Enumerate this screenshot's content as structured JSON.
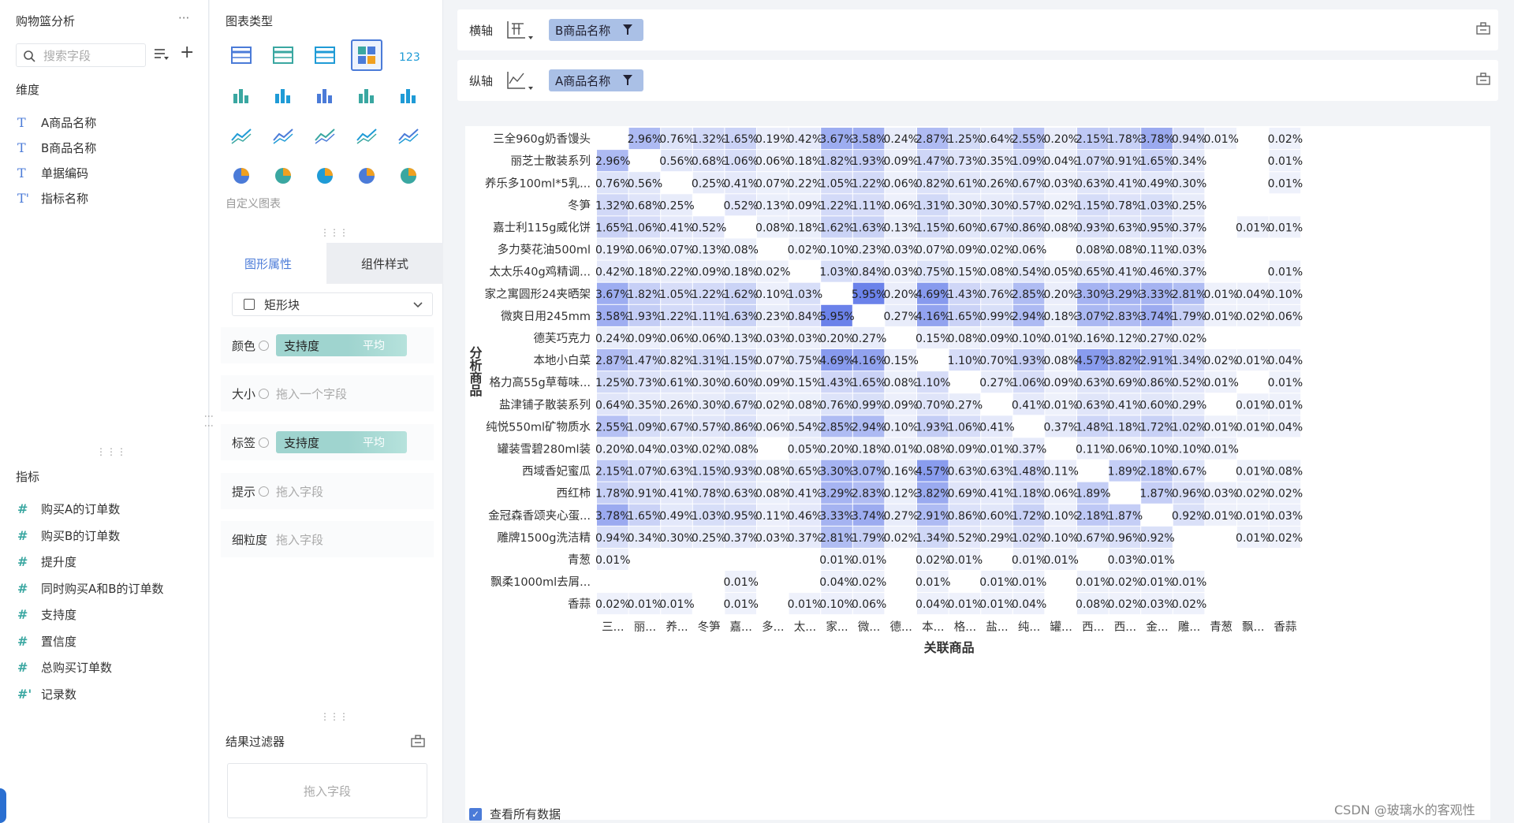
{
  "left_panel": {
    "title": "购物篮分析",
    "more": "···",
    "search_placeholder": "搜索字段",
    "dimensions_label": "维度",
    "dimensions": [
      {
        "icon": "T",
        "label": "A商品名称"
      },
      {
        "icon": "T",
        "label": "B商品名称"
      },
      {
        "icon": "T",
        "label": "单据编码"
      },
      {
        "icon": "T'",
        "label": "指标名称"
      }
    ],
    "measures_label": "指标",
    "measures": [
      {
        "icon": "#",
        "label": "购买A的订单数"
      },
      {
        "icon": "#",
        "label": "购买B的订单数"
      },
      {
        "icon": "#",
        "label": "提升度"
      },
      {
        "icon": "#",
        "label": "同时购买A和B的订单数"
      },
      {
        "icon": "#",
        "label": "支持度"
      },
      {
        "icon": "#",
        "label": "置信度"
      },
      {
        "icon": "#",
        "label": "总购买订单数"
      },
      {
        "icon": "#'",
        "label": "记录数"
      }
    ]
  },
  "config_panel": {
    "chart_type_title": "图表类型",
    "custom_chart_label": "自定义图表",
    "tab_graph": "图形属性",
    "tab_component": "组件样式",
    "shape_label": "矩形块",
    "props": [
      {
        "label": "颜色",
        "pill_name": "支持度",
        "pill_agg": "平均",
        "placeholder": ""
      },
      {
        "label": "大小",
        "pill_name": "",
        "pill_agg": "",
        "placeholder": "拖入一个字段"
      },
      {
        "label": "标签",
        "pill_name": "支持度",
        "pill_agg": "平均",
        "placeholder": ""
      },
      {
        "label": "提示",
        "pill_name": "",
        "pill_agg": "",
        "placeholder": "拖入字段"
      },
      {
        "label": "细粒度",
        "pill_name": "",
        "pill_agg": "",
        "placeholder": "拖入字段"
      }
    ],
    "result_filter_title": "结果过滤器",
    "filter_placeholder": "拖入字段",
    "chart_type_icons": [
      "table-icon",
      "cross-table-icon",
      "detail-table-icon",
      "heatmap-icon",
      "kpi-number-icon",
      "stacked-bar-icon",
      "bar-chart-icon",
      "grouped-bar-icon",
      "horizontal-bar-icon",
      "scatter-step-icon",
      "line-chart-icon",
      "line-point-icon",
      "radar-icon",
      "area-chart-icon",
      "gauge-icon",
      "pie-chart-icon",
      "rose-chart-icon",
      "donut-chart-icon",
      "scatter-icon",
      "bubble-icon"
    ]
  },
  "axes": {
    "x_label": "横轴",
    "x_field": "B商品名称",
    "y_label": "纵轴",
    "y_field": "A商品名称"
  },
  "view_all_data": "查看所有数据",
  "watermark": "CSDN @玻璃水的客观性",
  "colors": {
    "accent": "#4b7bd8",
    "heat_low": "#eef1fb",
    "heat_high": "#6b82ea"
  },
  "chart_data": {
    "type": "heatmap",
    "ylabel": "分析商品",
    "xlabel": "关联商品",
    "rows": [
      "三全960g奶香馒头",
      "丽芝士散装系列",
      "养乐多100ml*5乳...",
      "冬笋",
      "嘉士利115g威化饼",
      "多力葵花油500ml",
      "太太乐40g鸡精调...",
      "家之寓圆形24夹晒架",
      "微爽日用245mm",
      "德芙巧克力",
      "本地小白菜",
      "格力高55g草莓味...",
      "盐津铺子散装系列",
      "纯悦550ml矿物质水",
      "罐装雪碧280ml装",
      "西域香妃蜜瓜",
      "西红柿",
      "金冠森香颂夹心蛋...",
      "雕牌1500g洗洁精",
      "青葱",
      "飘柔1000ml去屑...",
      "香蒜"
    ],
    "columns": [
      "三...",
      "丽...",
      "养...",
      "冬笋",
      "嘉...",
      "多...",
      "太...",
      "家...",
      "微...",
      "德...",
      "本...",
      "格...",
      "盐...",
      "纯...",
      "罐...",
      "西...",
      "西...",
      "金...",
      "雕...",
      "青葱",
      "飘...",
      "香蒜"
    ],
    "values": [
      [
        null,
        2.96,
        0.76,
        1.32,
        1.65,
        0.19,
        0.42,
        3.67,
        3.58,
        0.24,
        2.87,
        1.25,
        0.64,
        2.55,
        0.2,
        2.15,
        1.78,
        3.78,
        0.94,
        0.01,
        null,
        0.02
      ],
      [
        2.96,
        null,
        0.56,
        0.68,
        1.06,
        0.06,
        0.18,
        1.82,
        1.93,
        0.09,
        1.47,
        0.73,
        0.35,
        1.09,
        0.04,
        1.07,
        0.91,
        1.65,
        0.34,
        null,
        null,
        0.01
      ],
      [
        0.76,
        0.56,
        null,
        0.25,
        0.41,
        0.07,
        0.22,
        1.05,
        1.22,
        0.06,
        0.82,
        0.61,
        0.26,
        0.67,
        0.03,
        0.63,
        0.41,
        0.49,
        0.3,
        null,
        null,
        0.01
      ],
      [
        1.32,
        0.68,
        0.25,
        null,
        0.52,
        0.13,
        0.09,
        1.22,
        1.11,
        0.06,
        1.31,
        0.3,
        0.3,
        0.57,
        0.02,
        1.15,
        0.78,
        1.03,
        0.25,
        null,
        null,
        null
      ],
      [
        1.65,
        1.06,
        0.41,
        0.52,
        null,
        0.08,
        0.18,
        1.62,
        1.63,
        0.13,
        1.15,
        0.6,
        0.67,
        0.86,
        0.08,
        0.93,
        0.63,
        0.95,
        0.37,
        null,
        0.01,
        0.01
      ],
      [
        0.19,
        0.06,
        0.07,
        0.13,
        0.08,
        null,
        0.02,
        0.1,
        0.23,
        0.03,
        0.07,
        0.09,
        0.02,
        0.06,
        null,
        0.08,
        0.08,
        0.11,
        0.03,
        null,
        null,
        null
      ],
      [
        0.42,
        0.18,
        0.22,
        0.09,
        0.18,
        0.02,
        null,
        1.03,
        0.84,
        0.03,
        0.75,
        0.15,
        0.08,
        0.54,
        0.05,
        0.65,
        0.41,
        0.46,
        0.37,
        null,
        null,
        0.01
      ],
      [
        3.67,
        1.82,
        1.05,
        1.22,
        1.62,
        0.1,
        1.03,
        null,
        5.95,
        0.2,
        4.69,
        1.43,
        0.76,
        2.85,
        0.2,
        3.3,
        3.29,
        3.33,
        2.81,
        0.01,
        0.04,
        0.1
      ],
      [
        3.58,
        1.93,
        1.22,
        1.11,
        1.63,
        0.23,
        0.84,
        5.95,
        null,
        0.27,
        4.16,
        1.65,
        0.99,
        2.94,
        0.18,
        3.07,
        2.83,
        3.74,
        1.79,
        0.01,
        0.02,
        0.06
      ],
      [
        0.24,
        0.09,
        0.06,
        0.06,
        0.13,
        0.03,
        0.03,
        0.2,
        0.27,
        null,
        0.15,
        0.08,
        0.09,
        0.1,
        0.01,
        0.16,
        0.12,
        0.27,
        0.02,
        null,
        null,
        null
      ],
      [
        2.87,
        1.47,
        0.82,
        1.31,
        1.15,
        0.07,
        0.75,
        4.69,
        4.16,
        0.15,
        null,
        1.1,
        0.7,
        1.93,
        0.08,
        4.57,
        3.82,
        2.91,
        1.34,
        0.02,
        0.01,
        0.04
      ],
      [
        1.25,
        0.73,
        0.61,
        0.3,
        0.6,
        0.09,
        0.15,
        1.43,
        1.65,
        0.08,
        1.1,
        null,
        0.27,
        1.06,
        0.09,
        0.63,
        0.69,
        0.86,
        0.52,
        0.01,
        null,
        0.01
      ],
      [
        0.64,
        0.35,
        0.26,
        0.3,
        0.67,
        0.02,
        0.08,
        0.76,
        0.99,
        0.09,
        0.7,
        0.27,
        null,
        0.41,
        0.01,
        0.63,
        0.41,
        0.6,
        0.29,
        null,
        0.01,
        0.01
      ],
      [
        2.55,
        1.09,
        0.67,
        0.57,
        0.86,
        0.06,
        0.54,
        2.85,
        2.94,
        0.1,
        1.93,
        1.06,
        0.41,
        null,
        0.37,
        1.48,
        1.18,
        1.72,
        1.02,
        0.01,
        0.01,
        0.04
      ],
      [
        0.2,
        0.04,
        0.03,
        0.02,
        0.08,
        null,
        0.05,
        0.2,
        0.18,
        0.01,
        0.08,
        0.09,
        0.01,
        0.37,
        null,
        0.11,
        0.06,
        0.1,
        0.1,
        0.01,
        null,
        null
      ],
      [
        2.15,
        1.07,
        0.63,
        1.15,
        0.93,
        0.08,
        0.65,
        3.3,
        3.07,
        0.16,
        4.57,
        0.63,
        0.63,
        1.48,
        0.11,
        null,
        1.89,
        2.18,
        0.67,
        null,
        0.01,
        0.08
      ],
      [
        1.78,
        0.91,
        0.41,
        0.78,
        0.63,
        0.08,
        0.41,
        3.29,
        2.83,
        0.12,
        3.82,
        0.69,
        0.41,
        1.18,
        0.06,
        1.89,
        null,
        1.87,
        0.96,
        0.03,
        0.02,
        0.02
      ],
      [
        3.78,
        1.65,
        0.49,
        1.03,
        0.95,
        0.11,
        0.46,
        3.33,
        3.74,
        0.27,
        2.91,
        0.86,
        0.6,
        1.72,
        0.1,
        2.18,
        1.87,
        null,
        0.92,
        0.01,
        0.01,
        0.03
      ],
      [
        0.94,
        0.34,
        0.3,
        0.25,
        0.37,
        0.03,
        0.37,
        2.81,
        1.79,
        0.02,
        1.34,
        0.52,
        0.29,
        1.02,
        0.1,
        0.67,
        0.96,
        0.92,
        null,
        null,
        0.01,
        0.02
      ],
      [
        0.01,
        null,
        null,
        null,
        null,
        null,
        null,
        0.01,
        0.01,
        null,
        0.02,
        0.01,
        null,
        0.01,
        0.01,
        null,
        0.03,
        0.01,
        null,
        null,
        null,
        null
      ],
      [
        null,
        null,
        null,
        null,
        0.01,
        null,
        null,
        0.04,
        0.02,
        null,
        0.01,
        null,
        0.01,
        0.01,
        null,
        0.01,
        0.02,
        0.01,
        0.01,
        null,
        null,
        null
      ],
      [
        0.02,
        0.01,
        0.01,
        null,
        0.01,
        null,
        0.01,
        0.1,
        0.06,
        null,
        0.04,
        0.01,
        0.01,
        0.04,
        null,
        0.08,
        0.02,
        0.03,
        0.02,
        null,
        null,
        null
      ]
    ],
    "value_suffix": "%",
    "color_range": [
      0,
      5.95
    ]
  }
}
